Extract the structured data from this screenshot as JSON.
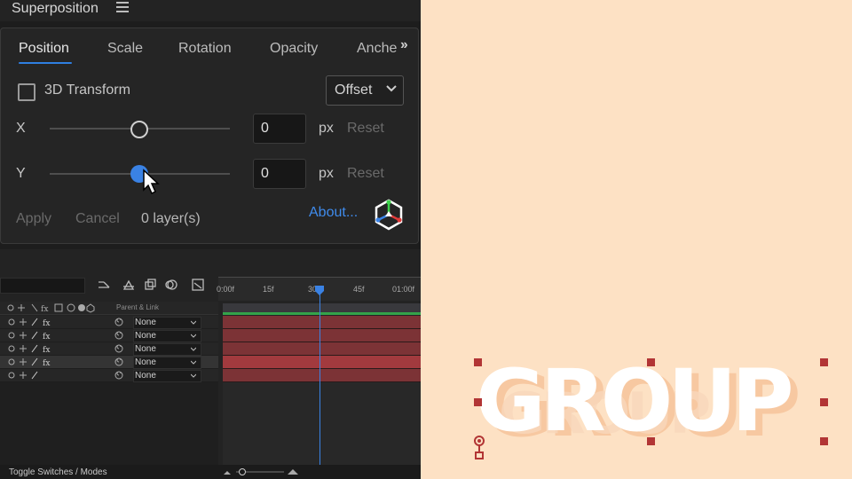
{
  "panel": {
    "title": "Superposition",
    "tabs": [
      "Position",
      "Scale",
      "Rotation",
      "Opacity",
      "Anche"
    ],
    "active_tab": 0,
    "transform_label": "3D Transform",
    "mode_select": "Offset",
    "x": {
      "label": "X",
      "value": "0",
      "unit": "px",
      "reset": "Reset"
    },
    "y": {
      "label": "Y",
      "value": "0",
      "unit": "px",
      "reset": "Reset"
    },
    "apply": "Apply",
    "cancel": "Cancel",
    "layers_count": "0 layer(s)",
    "about": "About..."
  },
  "timeline": {
    "ticks": [
      "0:00f",
      "15f",
      "30f",
      "45f",
      "01:00f"
    ],
    "parent_header": "Parent & Link",
    "rows": [
      {
        "parent": "None"
      },
      {
        "parent": "None"
      },
      {
        "parent": "None"
      },
      {
        "parent": "None"
      },
      {
        "parent": "None"
      }
    ],
    "footer": "Toggle Switches / Modes"
  },
  "canvas": {
    "text": "GROUP",
    "ghost_text": "GROUP"
  },
  "colors": {
    "accent": "#3a82e4",
    "canvas_bg": "#fde1c4",
    "layer_bar": "#7c3336",
    "handle": "#b23535"
  }
}
